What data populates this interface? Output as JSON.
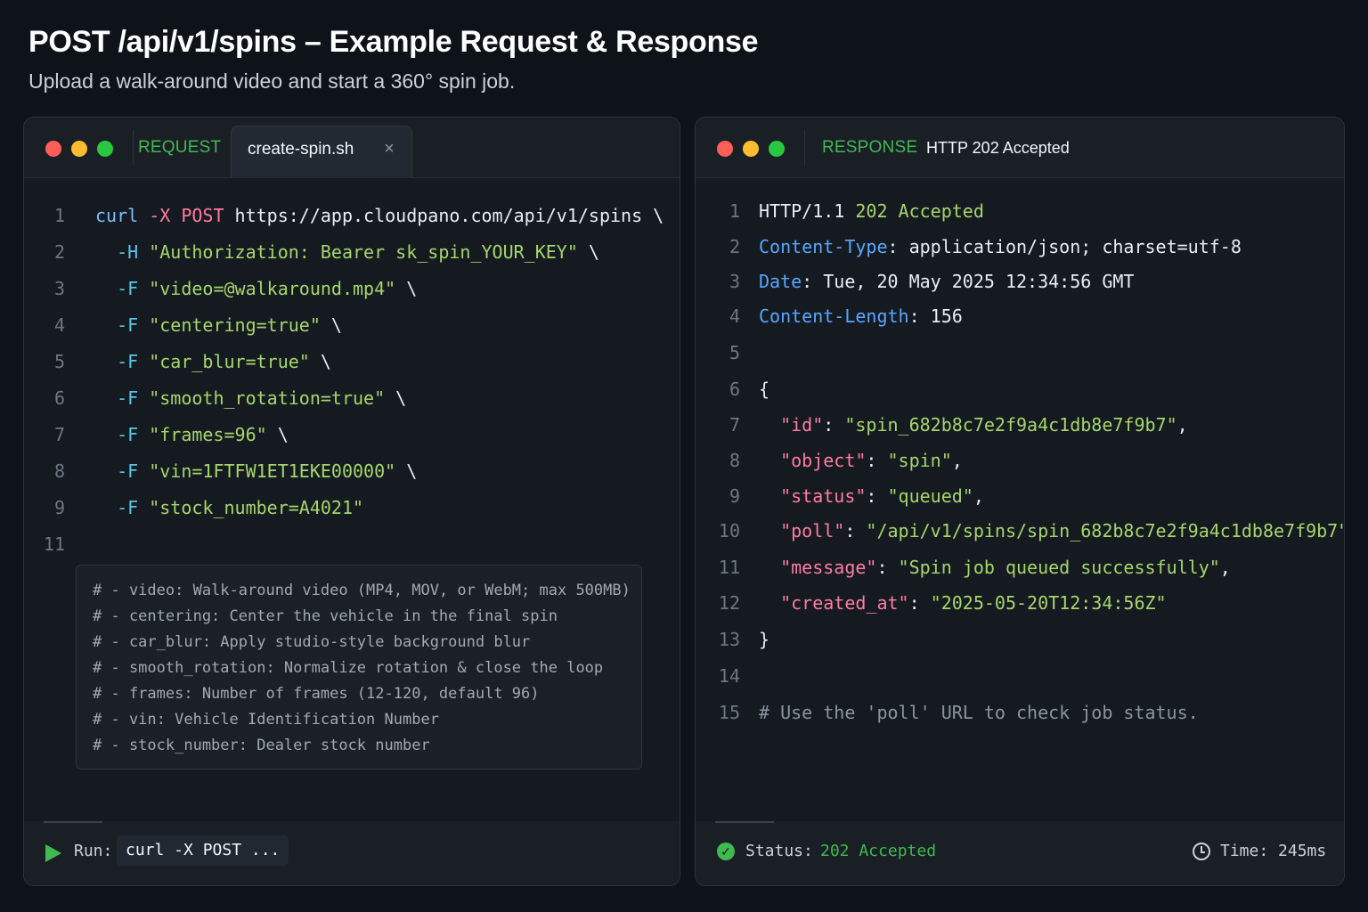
{
  "header": {
    "title": "POST /api/v1/spins – Example Request & Response",
    "subtitle": "Upload a walk-around video and start a 360° spin job."
  },
  "request": {
    "tab_label": "REQUEST",
    "file_name": "create-spin.sh",
    "lines": [
      {
        "n": "1",
        "parts": [
          [
            "curl ",
            "cyan"
          ],
          [
            "-X POST ",
            "pink"
          ],
          [
            "https://app.cloudpano.com/api/v1/spins \\",
            "white"
          ]
        ]
      },
      {
        "n": "2",
        "parts": [
          [
            "  -H ",
            "flag"
          ],
          [
            "\"Authorization: Bearer sk_spin_YOUR_KEY\"",
            "green"
          ],
          [
            " \\",
            "white"
          ]
        ]
      },
      {
        "n": "3",
        "parts": [
          [
            "  -F ",
            "flag"
          ],
          [
            "\"video=@walkaround.mp4\"",
            "green"
          ],
          [
            " \\",
            "white"
          ]
        ]
      },
      {
        "n": "4",
        "parts": [
          [
            "  -F ",
            "flag"
          ],
          [
            "\"centering=true\"",
            "green"
          ],
          [
            " \\",
            "white"
          ]
        ]
      },
      {
        "n": "5",
        "parts": [
          [
            "  -F ",
            "flag"
          ],
          [
            "\"car_blur=true\"",
            "green"
          ],
          [
            " \\",
            "white"
          ]
        ]
      },
      {
        "n": "6",
        "parts": [
          [
            "  -F ",
            "flag"
          ],
          [
            "\"smooth_rotation=true\"",
            "green"
          ],
          [
            " \\",
            "white"
          ]
        ]
      },
      {
        "n": "7",
        "parts": [
          [
            "  -F ",
            "flag"
          ],
          [
            "\"frames=96\"",
            "green"
          ],
          [
            " \\",
            "white"
          ]
        ]
      },
      {
        "n": "8",
        "parts": [
          [
            "  -F ",
            "flag"
          ],
          [
            "\"vin=1FTFW1ET1EKE00000\"",
            "green"
          ],
          [
            " \\",
            "white"
          ]
        ]
      },
      {
        "n": "9",
        "parts": [
          [
            "  -F ",
            "flag"
          ],
          [
            "\"stock_number=A4021\"",
            "green"
          ]
        ]
      },
      {
        "n": "11",
        "parts": []
      }
    ],
    "comments": [
      "# - video: Walk-around video (MP4, MOV, or WebM; max 500MB)",
      "# - centering: Center the vehicle in the final spin",
      "# - car_blur: Apply studio-style background blur",
      "# - smooth_rotation: Normalize rotation & close the loop",
      "# - frames: Number of frames (12-120, default 96)",
      "# - vin: Vehicle Identification Number",
      "# - stock_number: Dealer stock number"
    ],
    "footer": {
      "run_label": "Run:",
      "run_command": "curl -X POST ..."
    }
  },
  "response": {
    "tab_label": "RESPONSE",
    "status_text": "HTTP 202 Accepted",
    "lines": [
      {
        "n": "1",
        "parts": [
          [
            "HTTP/1.1 ",
            "white"
          ],
          [
            "202 Accepted",
            "green"
          ]
        ]
      },
      {
        "n": "2",
        "parts": [
          [
            "Content-Type",
            "blue"
          ],
          [
            ": application/json; charset=utf-8",
            "white"
          ]
        ]
      },
      {
        "n": "3",
        "parts": [
          [
            "Date",
            "blue"
          ],
          [
            ": Tue, 20 May 2025 12:34:56 GMT",
            "white"
          ]
        ]
      },
      {
        "n": "4",
        "parts": [
          [
            "Content-Length",
            "blue"
          ],
          [
            ": 156",
            "white"
          ]
        ]
      },
      {
        "n": "5",
        "parts": []
      },
      {
        "n": "6",
        "parts": [
          [
            "{",
            "white"
          ]
        ]
      },
      {
        "n": "7",
        "parts": [
          [
            "  \"id\"",
            "key"
          ],
          [
            ": ",
            "white"
          ],
          [
            "\"spin_682b8c7e2f9a4c1db8e7f9b7\"",
            "green"
          ],
          [
            ",",
            "white"
          ]
        ]
      },
      {
        "n": "8",
        "parts": [
          [
            "  \"object\"",
            "key"
          ],
          [
            ": ",
            "white"
          ],
          [
            "\"spin\"",
            "green"
          ],
          [
            ",",
            "white"
          ]
        ]
      },
      {
        "n": "9",
        "parts": [
          [
            "  \"status\"",
            "key"
          ],
          [
            ": ",
            "white"
          ],
          [
            "\"queued\"",
            "green"
          ],
          [
            ",",
            "white"
          ]
        ]
      },
      {
        "n": "10",
        "parts": [
          [
            "  \"poll\"",
            "key"
          ],
          [
            ": ",
            "white"
          ],
          [
            "\"/api/v1/spins/spin_682b8c7e2f9a4c1db8e7f9b7\"",
            "green"
          ],
          [
            ",",
            "white"
          ]
        ]
      },
      {
        "n": "11",
        "parts": [
          [
            "  \"message\"",
            "key"
          ],
          [
            ": ",
            "white"
          ],
          [
            "\"Spin job queued successfully\"",
            "green"
          ],
          [
            ",",
            "white"
          ]
        ]
      },
      {
        "n": "12",
        "parts": [
          [
            "  \"created_at\"",
            "key"
          ],
          [
            ": ",
            "white"
          ],
          [
            "\"2025-05-20T12:34:56Z\"",
            "green"
          ]
        ]
      },
      {
        "n": "13",
        "parts": [
          [
            "}",
            "white"
          ]
        ]
      },
      {
        "n": "14",
        "parts": []
      },
      {
        "n": "15",
        "parts": [
          [
            "# Use the 'poll' URL to check job status.",
            "gray"
          ]
        ]
      }
    ],
    "footer": {
      "status_label": "Status:",
      "status_value": "202 Accepted",
      "time_label": "Time: 245ms"
    }
  },
  "icons": {
    "window_dots": [
      "red-dot-icon",
      "yellow-dot-icon",
      "green-dot-icon"
    ],
    "close": "close-icon",
    "run": "play-icon",
    "status": "check-circle-icon",
    "time": "clock-icon"
  },
  "colors": {
    "background": "#0e131a",
    "panel": "#151a21",
    "accent_green": "#3fb950",
    "string_green": "#a5d66a",
    "key_pink": "#ff7ba1",
    "header_blue": "#58a6ff"
  }
}
